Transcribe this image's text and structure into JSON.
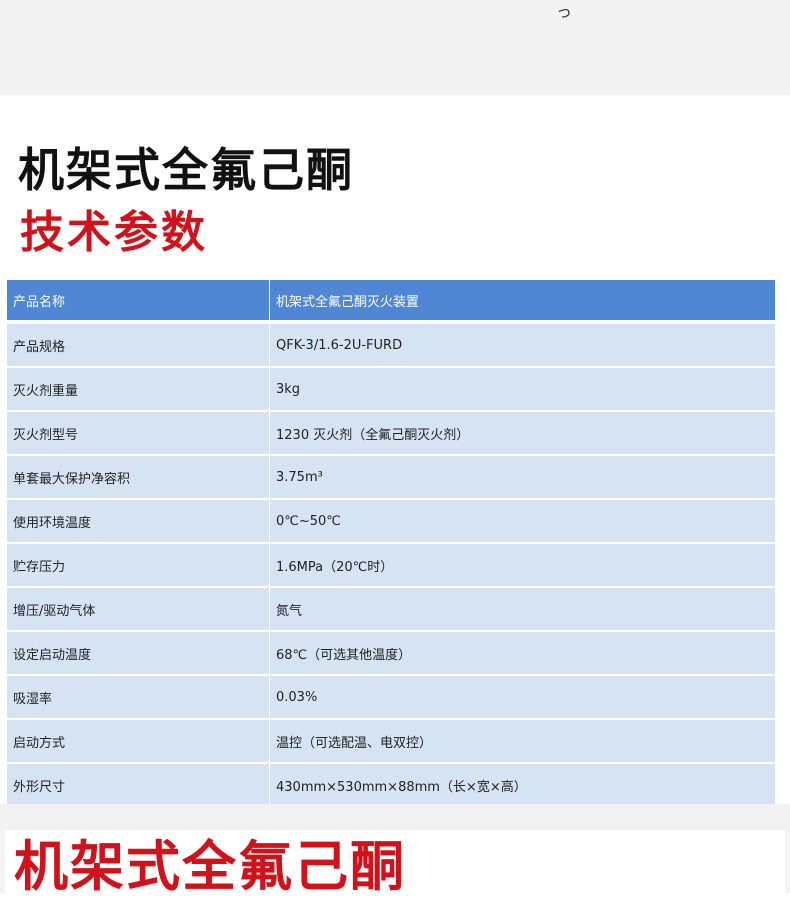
{
  "header": {
    "top_mark": "っ"
  },
  "titles": {
    "main": "机架式全氟己酮",
    "sub": "技术参数",
    "bottom": "机架式全氟己酮"
  },
  "table": {
    "header": {
      "label": "产品名称",
      "value": "机架式全氟己酮灭火装置"
    },
    "rows": [
      {
        "label": "产品规格",
        "value": "QFK-3/1.6-2U-FURD"
      },
      {
        "label": "灭火剂重量",
        "value": "3kg"
      },
      {
        "label": "灭火剂型号",
        "value": "1230 灭火剂（全氟己酮灭火剂）"
      },
      {
        "label": "单套最大保护净容积",
        "value": "3.75m³"
      },
      {
        "label": "使用环境温度",
        "value": "0℃~50℃"
      },
      {
        "label": "贮存压力",
        "value": "1.6MPa（20℃时）"
      },
      {
        "label": "增压/驱动气体",
        "value": "氮气"
      },
      {
        "label": "设定启动温度",
        "value": "68℃（可选其他温度）"
      },
      {
        "label": "吸湿率",
        "value": "0.03%"
      },
      {
        "label": "启动方式",
        "value": "温控（可选配温、电双控）"
      },
      {
        "label": "外形尺寸",
        "value": "430mm×530mm×88mm（长×宽×高）"
      }
    ]
  },
  "colors": {
    "header_blue": "#5087d4",
    "row_blue": "#d5e3f3",
    "accent_red": "#d0121b",
    "title_black": "#111111"
  }
}
